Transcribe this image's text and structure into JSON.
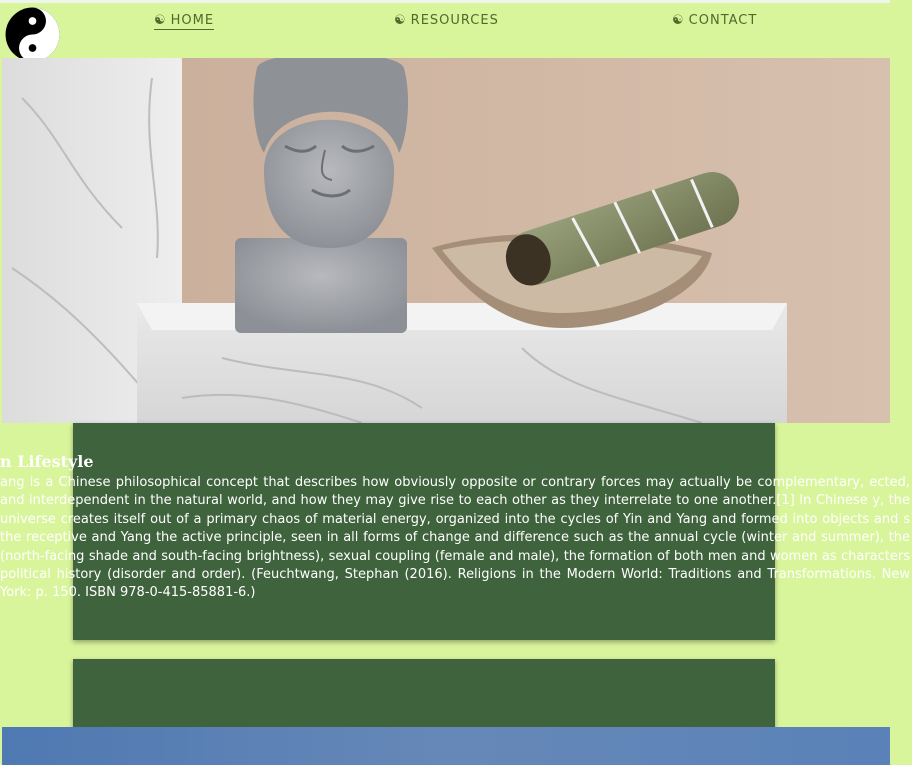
{
  "nav": {
    "items": [
      {
        "label": "HOME",
        "active": true
      },
      {
        "label": "RESOURCES",
        "active": false
      },
      {
        "label": "CONTACT",
        "active": false
      }
    ]
  },
  "hero": {
    "subject": "stone buddha head and sage bundle on marble shelf"
  },
  "content": {
    "heading": "n Lifestyle",
    "body": "ang is a Chinese philosophical concept that describes how obviously opposite or contrary forces may actually be complementary, ected, and interdependent in the natural world, and how they may give rise to each other as they interrelate to one another.[1] In Chinese y, the universe creates itself out of a primary chaos of material energy, organized into the cycles of Yin and Yang and formed into objects and s the receptive and Yang the active principle, seen in all forms of change and difference such as the annual cycle (winter and summer), the (north-facing shade and south-facing brightness), sexual coupling (female and male), the formation of both men and women as characters political history (disorder and order). (Feuchtwang, Stephan (2016). Religions in the Modern World: Traditions and Transformations. New York: p. 150. ISBN 978-0-415-85881-6.)"
  },
  "colors": {
    "page_bg": "#d9f59c",
    "panel_bg": "#3f633d",
    "nav_text": "#4f6a2b",
    "bottom_band": "#5a82b8"
  }
}
